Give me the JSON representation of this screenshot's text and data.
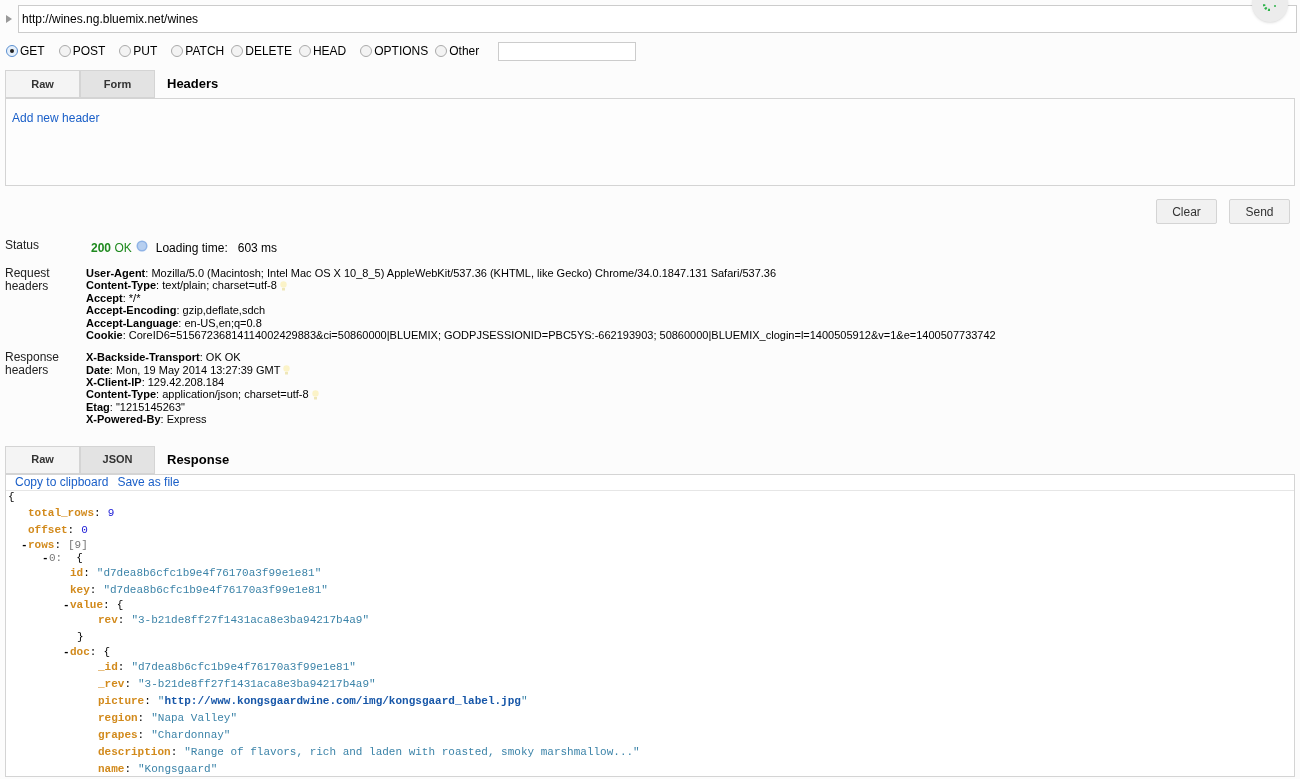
{
  "url": {
    "value": "http://wines.ng.bluemix.net/wines"
  },
  "methods": [
    {
      "label": "GET",
      "selected": true
    },
    {
      "label": "POST",
      "selected": false
    },
    {
      "label": "PUT",
      "selected": false
    },
    {
      "label": "PATCH",
      "selected": false
    },
    {
      "label": "DELETE",
      "selected": false
    },
    {
      "label": "HEAD",
      "selected": false
    },
    {
      "label": "OPTIONS",
      "selected": false
    },
    {
      "label": "Other",
      "selected": false
    }
  ],
  "header_tabs": [
    {
      "label": "Raw",
      "selected": false
    },
    {
      "label": "Form",
      "selected": true
    }
  ],
  "header_title": "Headers",
  "add_header_link": "Add new header",
  "buttons": [
    "Clear",
    "Send"
  ],
  "status": {
    "label": "Status",
    "code": "200",
    "text": "OK",
    "loading_label": "Loading time:",
    "loading_value": "603 ms"
  },
  "request_headers": {
    "label": "Request headers",
    "items": [
      {
        "name": "User-Agent",
        "sep": ":",
        "value": "Mozilla/5.0 (Macintosh; Intel Mac OS X 10_8_5) AppleWebKit/537.36 (KHTML, like Gecko) Chrome/34.0.1847.131 Safari/537.36",
        "hint": false
      },
      {
        "name": "Content-Type",
        "sep": ":",
        "value": "text/plain; charset=utf-8",
        "hint": true
      },
      {
        "name": "Accept",
        "sep": ":",
        "value": "*/*",
        "hint": false
      },
      {
        "name": "Accept-Encoding",
        "sep": ":",
        "value": "gzip,deflate,sdch",
        "hint": false
      },
      {
        "name": "Accept-Language",
        "sep": ":",
        "value": "en-US,en;q=0.8",
        "hint": false
      },
      {
        "name": "Cookie",
        "sep": ":",
        "value": "CoreID6=51567236814114002429883&ci=50860000|BLUEMIX; GODPJSESSIONID=PBC5YS:-662193903; 50860000|BLUEMIX_clogin=l=1400505912&v=1&e=1400507733742",
        "hint": false
      }
    ]
  },
  "response_headers": {
    "label": "Response headers",
    "items": [
      {
        "name": "X-Backside-Transport",
        "sep": ":",
        "value": "OK OK",
        "hint": false
      },
      {
        "name": "Date",
        "sep": ":",
        "value": "Mon, 19 May 2014 13:27:39 GMT",
        "hint": true
      },
      {
        "name": "X-Client-IP",
        "sep": ":",
        "value": "129.42.208.184",
        "hint": false
      },
      {
        "name": "Content-Type",
        "sep": ":",
        "value": "application/json; charset=utf-8",
        "hint": true
      },
      {
        "name": "Etag",
        "sep": ":",
        "value": "\"1215145263\"",
        "hint": false
      },
      {
        "name": "X-Powered-By",
        "sep": ":",
        "value": "Express",
        "hint": false
      }
    ]
  },
  "response_tabs": [
    {
      "label": "Raw",
      "selected": false
    },
    {
      "label": "JSON",
      "selected": true
    }
  ],
  "response_title": "Response",
  "response_links": [
    "Copy to clipboard",
    "Save as file"
  ],
  "response_body": {
    "open": "{",
    "children": [
      {
        "key": "total_rows",
        "sep": ":",
        "kind": "number",
        "value": "9"
      },
      {
        "key": "offset",
        "sep": ":",
        "kind": "number",
        "value": "0"
      },
      {
        "key": "rows",
        "sep": ":",
        "kind": "array",
        "toggle": "-",
        "open": "[9]",
        "children": [
          {
            "key": "0",
            "sep": ":",
            "kind": "index",
            "toggle": "-",
            "open": "{",
            "children": [
              {
                "key": "id",
                "sep": ":",
                "kind": "string",
                "value": "\"d7dea8b6cfc1b9e4f76170a3f99e1e81\""
              },
              {
                "key": "key",
                "sep": ":",
                "kind": "string",
                "value": "\"d7dea8b6cfc1b9e4f76170a3f99e1e81\""
              },
              {
                "key": "value",
                "sep": ":",
                "kind": "object",
                "toggle": "-",
                "open": "{",
                "close": "}",
                "children": [
                  {
                    "key": "rev",
                    "sep": ":",
                    "kind": "string",
                    "value": "\"3-b21de8ff27f1431aca8e3ba94217b4a9\""
                  }
                ]
              },
              {
                "key": "doc",
                "sep": ":",
                "kind": "object",
                "toggle": "-",
                "open": "{",
                "children": [
                  {
                    "key": "_id",
                    "sep": ":",
                    "kind": "string",
                    "value": "\"d7dea8b6cfc1b9e4f76170a3f99e1e81\""
                  },
                  {
                    "key": "_rev",
                    "sep": ":",
                    "kind": "string",
                    "value": "\"3-b21de8ff27f1431aca8e3ba94217b4a9\""
                  },
                  {
                    "key": "picture",
                    "sep": ":",
                    "kind": "link",
                    "value": "http://www.kongsgaardwine.com/img/kongsgaard_label.jpg",
                    "quote": "\""
                  },
                  {
                    "key": "region",
                    "sep": ":",
                    "kind": "string",
                    "value": "\"Napa Valley\""
                  },
                  {
                    "key": "grapes",
                    "sep": ":",
                    "kind": "string",
                    "value": "\"Chardonnay\""
                  },
                  {
                    "key": "description",
                    "sep": ":",
                    "kind": "string",
                    "value": "\"Range of flavors, rich and laden with roasted, smoky marshmallow...\""
                  },
                  {
                    "key": "name",
                    "sep": ":",
                    "kind": "string",
                    "value": "\"Kongsgaard\""
                  }
                ]
              }
            ]
          }
        ]
      }
    ]
  }
}
